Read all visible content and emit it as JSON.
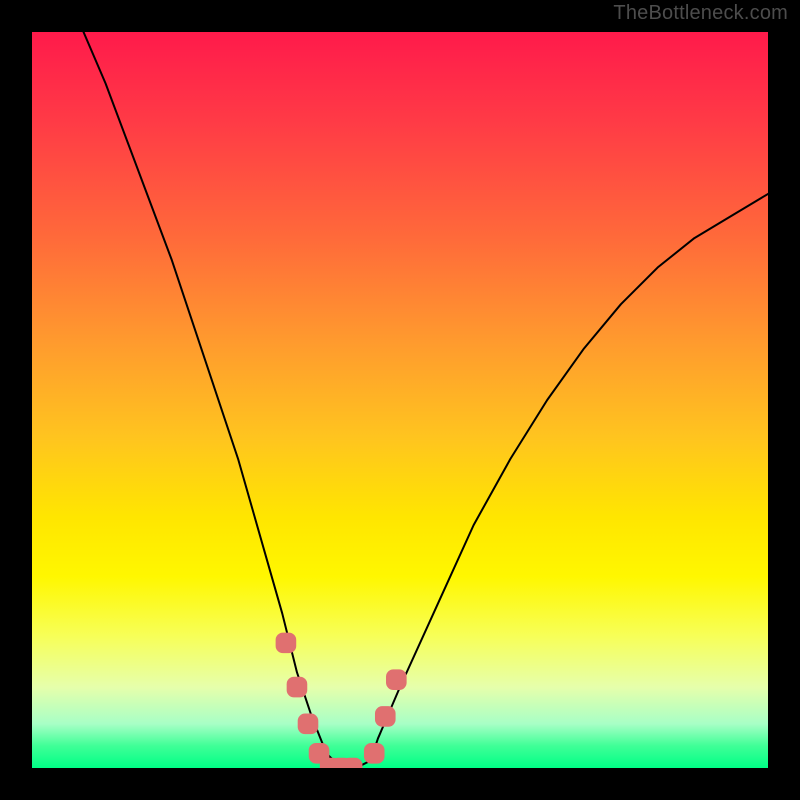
{
  "watermark": "TheBottleneck.com",
  "chart_data": {
    "type": "line",
    "title": "",
    "xlabel": "",
    "ylabel": "",
    "xlim": [
      0,
      100
    ],
    "ylim": [
      0,
      100
    ],
    "grid": false,
    "legend": false,
    "series": [
      {
        "name": "black-curve",
        "type": "line",
        "color": "#000000",
        "x": [
          7,
          10,
          13,
          16,
          19,
          22,
          25,
          28,
          30,
          32,
          34,
          35,
          36,
          38,
          40,
          42,
          44,
          46,
          47,
          50,
          55,
          60,
          65,
          70,
          75,
          80,
          85,
          90,
          95,
          100
        ],
        "y": [
          100,
          93,
          85,
          77,
          69,
          60,
          51,
          42,
          35,
          28,
          21,
          17,
          13,
          7,
          2,
          0,
          0,
          1,
          4,
          11,
          22,
          33,
          42,
          50,
          57,
          63,
          68,
          72,
          75,
          78
        ]
      },
      {
        "name": "floor-markers",
        "type": "marker",
        "color": "#e07070",
        "shape": "rounded-square",
        "x": [
          34.5,
          36.0,
          37.5,
          39.0,
          40.5,
          42.0,
          43.5,
          46.5,
          48.0,
          49.5
        ],
        "y": [
          17,
          11,
          6,
          2,
          0,
          0,
          0,
          2,
          7,
          12
        ]
      }
    ],
    "background_gradient_stops": [
      {
        "pos": 0.0,
        "color": "#ff1a4b"
      },
      {
        "pos": 0.12,
        "color": "#ff3a46"
      },
      {
        "pos": 0.28,
        "color": "#ff6a3a"
      },
      {
        "pos": 0.42,
        "color": "#ff9a2e"
      },
      {
        "pos": 0.55,
        "color": "#ffc41f"
      },
      {
        "pos": 0.66,
        "color": "#ffe600"
      },
      {
        "pos": 0.74,
        "color": "#fff700"
      },
      {
        "pos": 0.82,
        "color": "#f7ff57"
      },
      {
        "pos": 0.89,
        "color": "#e6ffab"
      },
      {
        "pos": 0.94,
        "color": "#a8ffc6"
      },
      {
        "pos": 0.97,
        "color": "#3fff97"
      },
      {
        "pos": 1.0,
        "color": "#00ff86"
      }
    ]
  }
}
